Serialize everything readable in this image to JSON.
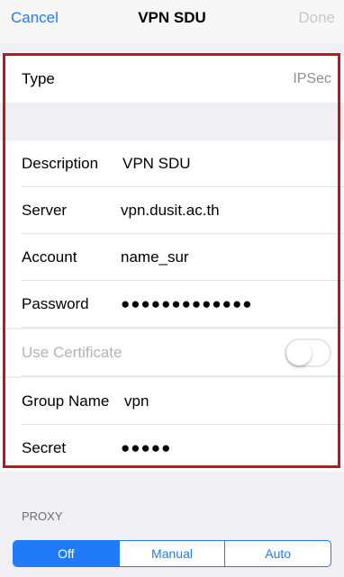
{
  "navbar": {
    "cancel_label": "Cancel",
    "title": "VPN SDU",
    "done_label": "Done"
  },
  "form": {
    "type": {
      "label": "Type",
      "value": "IPSec"
    },
    "description": {
      "label": "Description",
      "value": "VPN SDU"
    },
    "server": {
      "label": "Server",
      "value": "vpn.dusit.ac.th"
    },
    "account": {
      "label": "Account",
      "value": "name_sur"
    },
    "password": {
      "label": "Password",
      "value": "●●●●●●●●●●●●●"
    },
    "use_certificate": {
      "label": "Use Certificate",
      "enabled": false
    },
    "group_name": {
      "label": "Group Name",
      "value": "vpn"
    },
    "secret": {
      "label": "Secret",
      "value": "●●●●●"
    }
  },
  "proxy": {
    "header": "PROXY",
    "options": [
      "Off",
      "Manual",
      "Auto"
    ],
    "selected": "Off"
  },
  "colors": {
    "accent": "#1f7cf6",
    "highlight_border": "#c0141f"
  }
}
